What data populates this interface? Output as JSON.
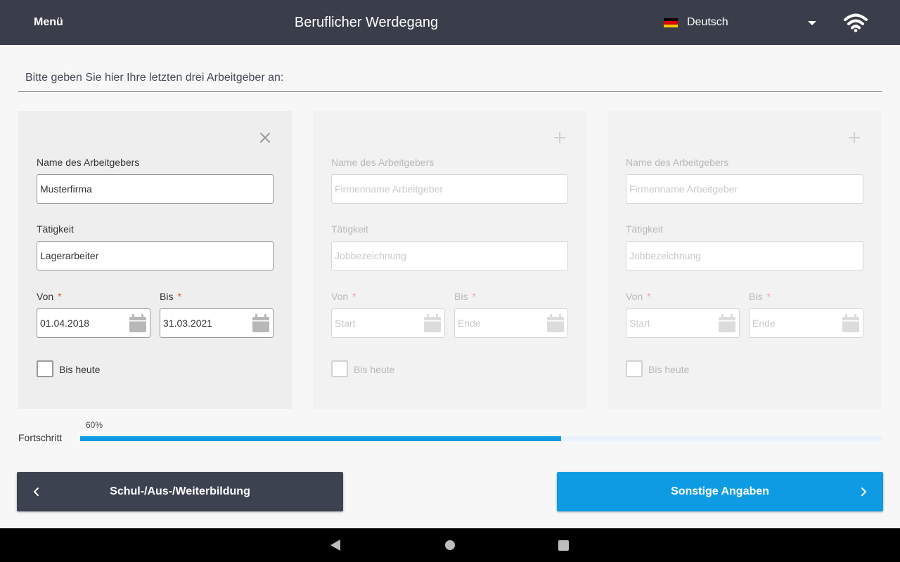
{
  "header": {
    "menu_label": "Menü",
    "title": "Beruflicher Werdegang",
    "language": {
      "label": "Deutsch",
      "flag_colors": [
        "#000000",
        "#dd0000",
        "#ffce00"
      ],
      "icon": "chevron-down-icon"
    },
    "status_icon": "wifi-icon"
  },
  "intro": "Bitte geben Sie hier Ihre letzten drei Arbeitgeber an:",
  "employers": [
    {
      "action_icon": "close-icon",
      "name_label": "Name des Arbeitgebers",
      "name_value": "Musterfirma",
      "name_placeholder": "Firmenname Arbeitgeber",
      "job_label": "Tätigkeit",
      "job_value": "Lagerarbeiter",
      "job_placeholder": "Jobbezeichnung",
      "from_label": "Von",
      "from_value": "01.04.2018",
      "from_placeholder": "Start",
      "to_label": "Bis",
      "to_value": "31.03.2021",
      "to_placeholder": "Ende",
      "required_mark": "*",
      "checkbox_label": "Bis heute",
      "checked": false
    },
    {
      "action_icon": "plus-icon",
      "name_label": "Name des Arbeitgebers",
      "name_value": "",
      "name_placeholder": "Firmenname Arbeitgeber",
      "job_label": "Tätigkeit",
      "job_value": "",
      "job_placeholder": "Jobbezeichnung",
      "from_label": "Von",
      "from_value": "",
      "from_placeholder": "Start",
      "to_label": "Bis",
      "to_value": "",
      "to_placeholder": "Ende",
      "required_mark": "*",
      "checkbox_label": "Bis heute",
      "checked": false
    },
    {
      "action_icon": "plus-icon",
      "name_label": "Name des Arbeitgebers",
      "name_value": "",
      "name_placeholder": "Firmenname Arbeitgeber",
      "job_label": "Tätigkeit",
      "job_value": "",
      "job_placeholder": "Jobbezeichnung",
      "from_label": "Von",
      "from_value": "",
      "from_placeholder": "Start",
      "to_label": "Bis",
      "to_value": "",
      "to_placeholder": "Ende",
      "required_mark": "*",
      "checkbox_label": "Bis heute",
      "checked": false
    }
  ],
  "progress": {
    "label": "Fortschritt",
    "percent_text": "60%",
    "value": 0.6
  },
  "navigation": {
    "back_label": "Schul-/Aus-/Weiterbildung",
    "next_label": "Sonstige Angaben"
  },
  "colors": {
    "accent": "#0f9be3",
    "header_bg": "#3a3e4a",
    "required": "#e74c3c"
  }
}
